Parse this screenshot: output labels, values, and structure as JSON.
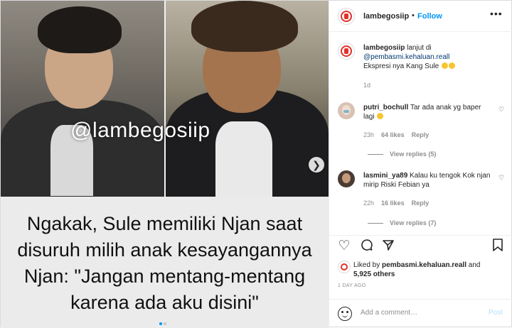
{
  "header": {
    "username": "lambegosiip",
    "separator": "•",
    "follow_label": "Follow",
    "more_icon": "more-horizontal-icon"
  },
  "media": {
    "watermark": "@lambegosiip",
    "caption_lines": [
      "Ngakak, Sule memiliki Njan saat",
      "disuruh milih anak kesayangannya",
      "Njan: \"Jangan mentang-mentang",
      "karena ada aku disini\""
    ],
    "next_icon": "chevron-right-icon",
    "slide_count": 2,
    "active_slide": 1
  },
  "caption_comment": {
    "username": "lambegosiip",
    "text_before_link": "lanjut di",
    "link": "@pembasmi.kehaluan.reall",
    "text_after": "Ekspresi nya Kang Sule",
    "age": "1d"
  },
  "comments": [
    {
      "username": "putri_bochull",
      "text": "Tar ada anak yg baper lagi",
      "age": "23h",
      "likes": "64 likes",
      "reply_label": "Reply",
      "view_replies": "View replies (5)"
    },
    {
      "username": "lasmini_ya89",
      "text": "Kalau ku tengok Kok njan mirip Riski Febian ya",
      "age": "22h",
      "likes": "16 likes",
      "reply_label": "Reply",
      "view_replies": "View replies (7)"
    }
  ],
  "actions": {
    "like_icon": "heart-icon",
    "comment_icon": "comment-icon",
    "share_icon": "send-icon",
    "save_icon": "bookmark-icon"
  },
  "likes_summary": {
    "prefix": "Liked by",
    "user": "pembasmi.kehaluan.reall",
    "conjunction": "and",
    "others": "5,925 others"
  },
  "timestamp": "1 DAY AGO",
  "add_comment": {
    "placeholder": "Add a comment…",
    "post_label": "Post",
    "emoji_icon": "smiley-icon"
  },
  "colors": {
    "link_blue": "#0095f6",
    "post_disabled": "#b2dffc",
    "border": "#dbdbdb",
    "secondary_text": "#8e8e8e",
    "brand_red": "#e0312a"
  }
}
